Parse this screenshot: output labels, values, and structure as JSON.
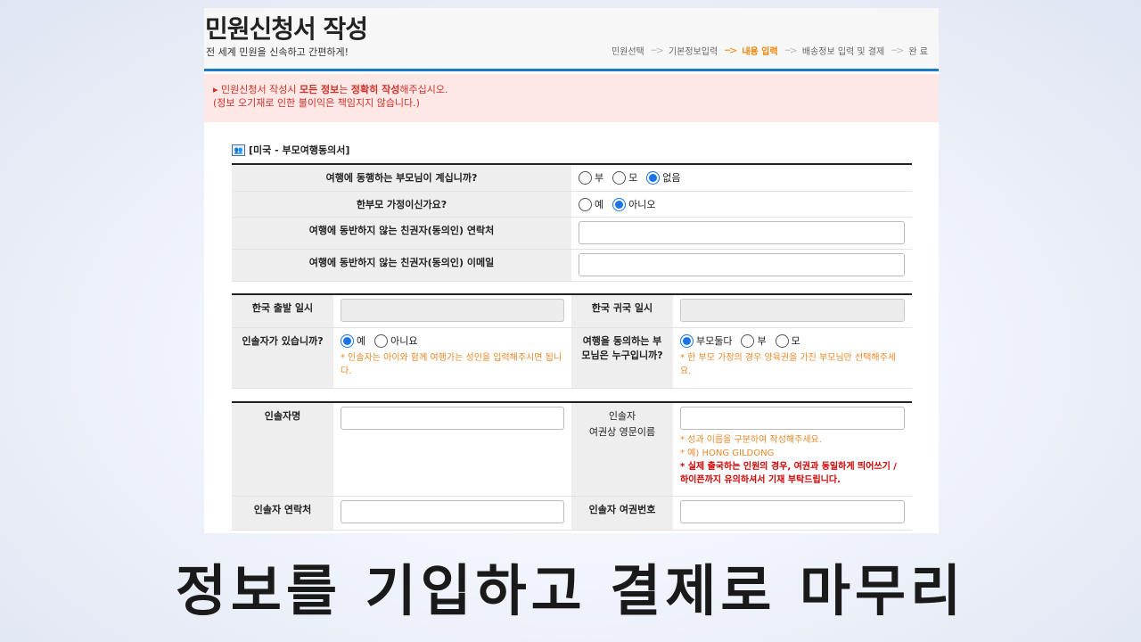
{
  "header": {
    "title": "민원신청서 작성",
    "subtitle": "전 세계 민원을 신속하고 간편하게!",
    "steps": [
      "민원선택",
      "기본정보입력",
      "내용 입력",
      "배송정보 입력 및 결제",
      "완 료"
    ]
  },
  "notice": {
    "prefix": "▸ 민원신청서 작성시 ",
    "bold1": "모든 정보",
    "mid1": "는 ",
    "bold2": "정확히 작성",
    "suffix": "해주십시오.",
    "line2": "(정보 오기재로 인한 불이익은 책임지지 않습니다.)"
  },
  "section": {
    "icon": "people-icon",
    "title": "[미국 - 부모여행동의서]"
  },
  "table1": {
    "q_parent": "여행에 동행하는 부모님이 계십니까?",
    "parent_options": [
      "부",
      "모",
      "없음"
    ],
    "q_single": "한부모 가정이신가요?",
    "single_options": [
      "예",
      "아니오"
    ],
    "q_contact": "여행에 동반하지 않는 친권자(동의인) 연락처",
    "contact_value": "",
    "q_email": "여행에 동반하지 않는 친권자(동의인) 이메일",
    "email_value": ""
  },
  "table2": {
    "depart_label": "한국 출발 일시",
    "depart_value": "",
    "return_label": "한국 귀국 일시",
    "return_value": "",
    "escort_label": "인솔자가 있습니까?",
    "escort_options": [
      "예",
      "아니요"
    ],
    "escort_note": "* 인솔자는 아이와 함께 여행가는 성인을 입력해주시면 됩니다.",
    "consent_label": "여행을 동의하는 부모님은 누구입니까?",
    "consent_options": [
      "부모둘다",
      "부",
      "모"
    ],
    "consent_note": "* 한 부모 가정의 경우 양육권을 가진 부모님만 선택해주세요."
  },
  "table3": {
    "name_label": "인솔자명",
    "name_value": "",
    "eng_label_1": "인솔자",
    "eng_label_2": "여권상 영문이름",
    "eng_value": "",
    "eng_note1": "* 성과 이름을 구분하여 작성해주세요.",
    "eng_note2": "* 예) HONG GILDONG",
    "eng_note3": "* 실제 출국하는 인원의 경우, 여권과 동일하게 띄어쓰기 / 하이픈까지 유의하셔서 기재 부탁드립니다.",
    "phone_label": "인솔자 연락처",
    "phone_value": "",
    "passport_label": "인솔자 여권번호",
    "passport_value": ""
  },
  "caption": "정보를 기입하고 결제로 마무리",
  "colors": {
    "accent_blue": "#1b7ac4",
    "step_active": "#f08300",
    "notice_bg": "#fde8e6",
    "notice_text": "#d0302a",
    "note_orange": "#e8882a",
    "note_red": "#d00000",
    "radio_on": "#1a73e8"
  }
}
